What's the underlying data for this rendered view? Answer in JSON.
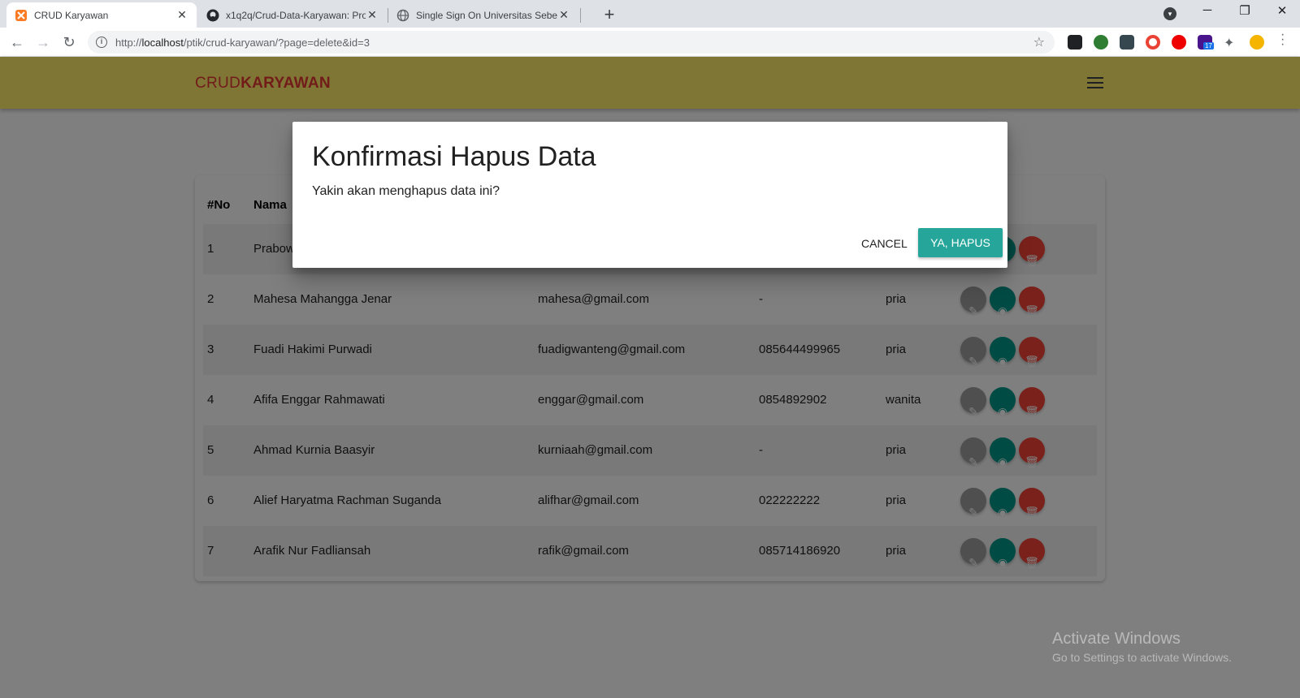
{
  "browser": {
    "tabs": [
      {
        "title": "CRUD Karyawan",
        "favicon": "xampp-icon",
        "active": true
      },
      {
        "title": "x1q2q/Crud-Data-Karyawan: Pro",
        "favicon": "github-icon",
        "active": false
      },
      {
        "title": "Single Sign On Universitas Sebel",
        "favicon": "globe-icon",
        "active": false
      }
    ],
    "new_tab": "+",
    "url_prefix": "http://",
    "url_host": "localhost",
    "url_path": "/ptik/crud-karyawan/?page=delete&id=3",
    "extension_badge": "17"
  },
  "navbar": {
    "brand_part1": "CRUD",
    "brand_part2": "KARYAWAN"
  },
  "table": {
    "headers": {
      "no": "#No",
      "nama": "Nama"
    },
    "rows": [
      {
        "no": "1",
        "nama": "Prabow",
        "email": "",
        "telp": "",
        "jk": ""
      },
      {
        "no": "2",
        "nama": "Mahesa Mahangga Jenar",
        "email": "mahesa@gmail.com",
        "telp": "-",
        "jk": "pria"
      },
      {
        "no": "3",
        "nama": "Fuadi Hakimi Purwadi",
        "email": "fuadigwanteng@gmail.com",
        "telp": "085644499965",
        "jk": "pria"
      },
      {
        "no": "4",
        "nama": "Afifa Enggar Rahmawati",
        "email": "enggar@gmail.com",
        "telp": "0854892902",
        "jk": "wanita"
      },
      {
        "no": "5",
        "nama": "Ahmad Kurnia Baasyir",
        "email": "kurniaah@gmail.com",
        "telp": "-",
        "jk": "pria"
      },
      {
        "no": "6",
        "nama": "Alief Haryatma Rachman Suganda",
        "email": "alifhar@gmail.com",
        "telp": "022222222",
        "jk": "pria"
      },
      {
        "no": "7",
        "nama": "Arafik Nur Fadliansah",
        "email": "rafik@gmail.com",
        "telp": "085714186920",
        "jk": "pria"
      }
    ]
  },
  "modal": {
    "title": "Konfirmasi Hapus Data",
    "message": "Yakin akan menghapus data ini?",
    "cancel_label": "CANCEL",
    "confirm_label": "YA, HAPUS"
  },
  "watermark": {
    "line1": "Activate Windows",
    "line2": "Go to Settings to activate Windows."
  },
  "colors": {
    "navbar": "#ffeb6b",
    "brand": "#e53935",
    "confirm_button": "#26a69a",
    "edit_button": "#9e9e9e",
    "view_button": "#009688",
    "delete_button": "#f44336"
  }
}
